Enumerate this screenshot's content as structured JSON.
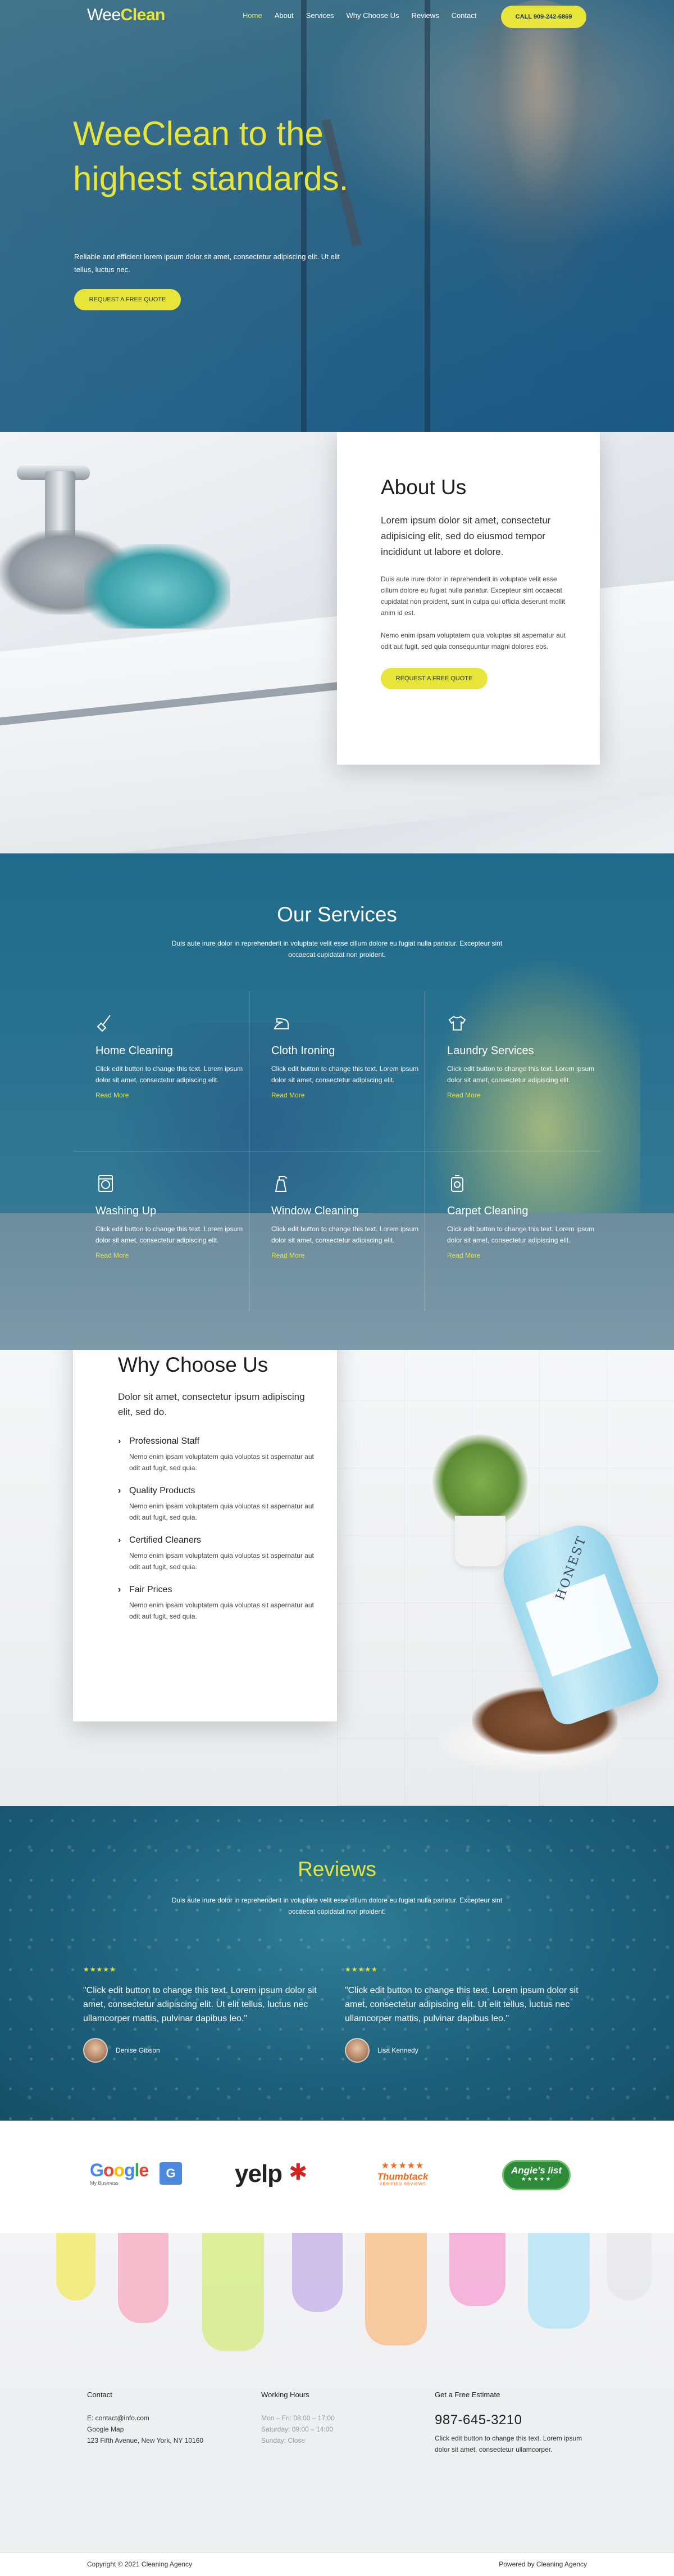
{
  "brand": {
    "logo_a": "Wee",
    "logo_b": "Clean"
  },
  "nav": {
    "links": [
      "Home",
      "About",
      "Services",
      "Why Choose Us",
      "Reviews",
      "Contact"
    ],
    "call_label": "CALL 909-242-6869"
  },
  "hero": {
    "title": "WeeClean to the highest standards.",
    "subtitle": "Reliable and efficient lorem ipsum dolor sit amet, consectetur adipiscing elit. Ut elit tellus, luctus nec.",
    "cta": "REQUEST A FREE QUOTE"
  },
  "about": {
    "title": "About Us",
    "lead": "Lorem ipsum dolor sit amet, consectetur adipisicing elit, sed do eiusmod tempor incididunt ut labore et dolore.",
    "p1": "Duis aute irure dolor in reprehenderit in voluptate velit esse cillum dolore eu fugiat nulla pariatur. Excepteur sint occaecat cupidatat non proident, sunt in culpa qui officia deserunt mollit anim id est.",
    "p2": "Nemo enim ipsam voluptatem quia voluptas sit aspernatur aut odit aut fugit, sed quia consequuntur magni dolores eos.",
    "cta": "REQUEST A FREE QUOTE"
  },
  "services": {
    "title": "Our Services",
    "subtitle": "Duis aute irure dolor in reprehenderit in voluptate velit esse cillum dolore eu fugiat nulla pariatur. Excepteur sint occaecat cupidatat non proident.",
    "items": [
      {
        "name": "Home Cleaning",
        "icon": "broom-icon",
        "text": "Click edit button to change this text. Lorem ipsum dolor sit amet, consectetur adipiscing elit.",
        "link": "Read More"
      },
      {
        "name": "Cloth Ironing",
        "icon": "iron-icon",
        "text": "Click edit button to change this text. Lorem ipsum dolor sit amet, consectetur adipiscing elit.",
        "link": "Read More"
      },
      {
        "name": "Laundry Services",
        "icon": "shirt-icon",
        "text": "Click edit button to change this text. Lorem ipsum dolor sit amet, consectetur adipiscing elit.",
        "link": "Read More"
      },
      {
        "name": "Washing Up",
        "icon": "washer-icon",
        "text": "Click edit button to change this text. Lorem ipsum dolor sit amet, consectetur adipiscing elit.",
        "link": "Read More"
      },
      {
        "name": "Window Cleaning",
        "icon": "spray-icon",
        "text": "Click edit button to change this text. Lorem ipsum dolor sit amet, consectetur adipiscing elit.",
        "link": "Read More"
      },
      {
        "name": "Carpet Cleaning",
        "icon": "vacuum-icon",
        "text": "Click edit button to change this text. Lorem ipsum dolor sit amet, consectetur adipiscing elit.",
        "link": "Read More"
      }
    ]
  },
  "why": {
    "title": "Why Choose Us",
    "lead": "Dolor sit amet, consectetur ipsum adipiscing elit, sed do.",
    "items": [
      {
        "head": "Professional Staff",
        "body": "Nemo enim ipsam voluptatem quia voluptas sit aspernatur aut odit aut fugit, sed quia."
      },
      {
        "head": "Quality Products",
        "body": "Nemo enim ipsam voluptatem quia voluptas sit aspernatur aut odit aut fugit, sed quia."
      },
      {
        "head": "Certified Cleaners",
        "body": "Nemo enim ipsam voluptatem quia voluptas sit aspernatur aut odit aut fugit, sed quia."
      },
      {
        "head": "Fair Prices",
        "body": "Nemo enim ipsam voluptatem quia voluptas sit aspernatur aut odit aut fugit, sed quia."
      }
    ],
    "product_brand": "HONEST"
  },
  "reviews": {
    "title": "Reviews",
    "subtitle": "Duis aute irure dolor in reprehenderit in voluptate velit esse cillum dolore eu fugiat nulla pariatur. Excepteur sint occaecat cupidatat non proident.",
    "items": [
      {
        "stars": "★★★★★",
        "rating": 5,
        "text": "\"Click edit button to change this text. Lorem ipsum dolor sit amet, consectetur adipiscing elit. Ut elit tellus, luctus nec ullamcorper mattis, pulvinar dapibus leo.\"",
        "name": "Denise Gibson"
      },
      {
        "stars": "★★★★★",
        "rating": 5,
        "text": "\"Click edit button to change this text. Lorem ipsum dolor sit amet, consectetur adipiscing elit. Ut elit tellus, luctus nec ullamcorper mattis, pulvinar dapibus leo.\"",
        "name": "Lisa Kennedy"
      }
    ]
  },
  "badges": {
    "google_word": [
      "G",
      "o",
      "o",
      "g",
      "l",
      "e"
    ],
    "google_sub": "My Business",
    "google_box": "G",
    "yelp": "yelp",
    "yelp_burst": "✱",
    "thumbtack_stars": "★★★★★",
    "thumbtack": "Thumbtack",
    "thumbtack_sub": "VERIFIED REVIEWS",
    "angies": "Angie's list",
    "angies_stars": "★★★★★"
  },
  "footer": {
    "contact_title": "Contact",
    "contact_lines": [
      "E: contact@info.com",
      "Google Map",
      "123 Fifth Avenue, New York, NY 10160"
    ],
    "hours_title": "Working Hours",
    "hours_lines": [
      "Mon – Fri: 08:00 – 17:00",
      "Saturday: 09:00 – 14:00",
      "Sunday: Close"
    ],
    "estimate_title": "Get a Free Estimate",
    "phone": "987-645-3210",
    "estimate_text": "Click edit button to change this text. Lorem ipsum dolor sit amet, consectetur ullamcorper.",
    "copyright": "Copyright © 2021 Cleaning Agency",
    "powered": "Powered by Cleaning Agency"
  },
  "colors": {
    "accent": "#e8e53a",
    "teal": "#1f6a8a",
    "dark": "#1d3346"
  }
}
